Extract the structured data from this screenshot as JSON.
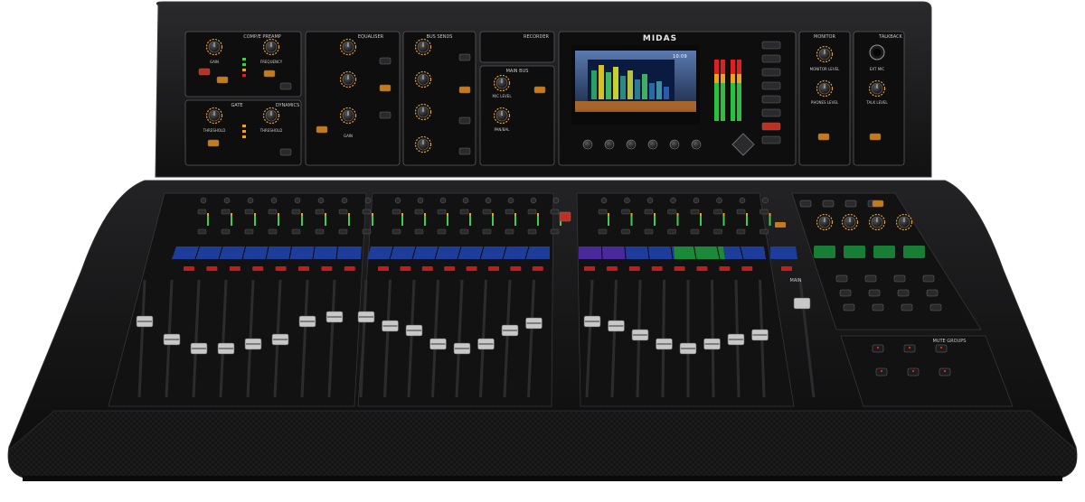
{
  "brand": {
    "logo": "MIDAS"
  },
  "panels": {
    "compressor": "COMP/E PREAMP",
    "equaliser": "EQUALISER",
    "bus_sends": "BUS SENDS",
    "recorder": "RECORDER",
    "main_bus": "MAIN BUS",
    "monitor": "MONITOR",
    "talkback": "TALKBACK",
    "gate": "GATE",
    "dynamics": "DYNAMICS",
    "mute_groups": "MUTE GROUPS",
    "main": "MAIN"
  },
  "knob_labels": {
    "gain": "GAIN",
    "frequency": "FREQUENCY",
    "threshold": "THRESHOLD",
    "m_c_level": "M/C LEVEL",
    "pan_bal": "PAN/BAL",
    "monitor_level": "MONITOR LEVEL",
    "phones_level": "PHONES LEVEL",
    "ext_mic": "EXT MIC",
    "talk_level": "TALK LEVEL"
  },
  "screen": {
    "time": "10:09"
  },
  "colors": {
    "body": "#1a1a1b",
    "panel": "#0e0e0f",
    "knob_ring": "#f0a020",
    "led_green": "#3ad04a",
    "led_red": "#e02020",
    "led_amber": "#f0a020",
    "scribble_blue": "#1e3c9a",
    "scribble_green": "#1a8a3a",
    "scribble_purple": "#4a2a9a"
  }
}
